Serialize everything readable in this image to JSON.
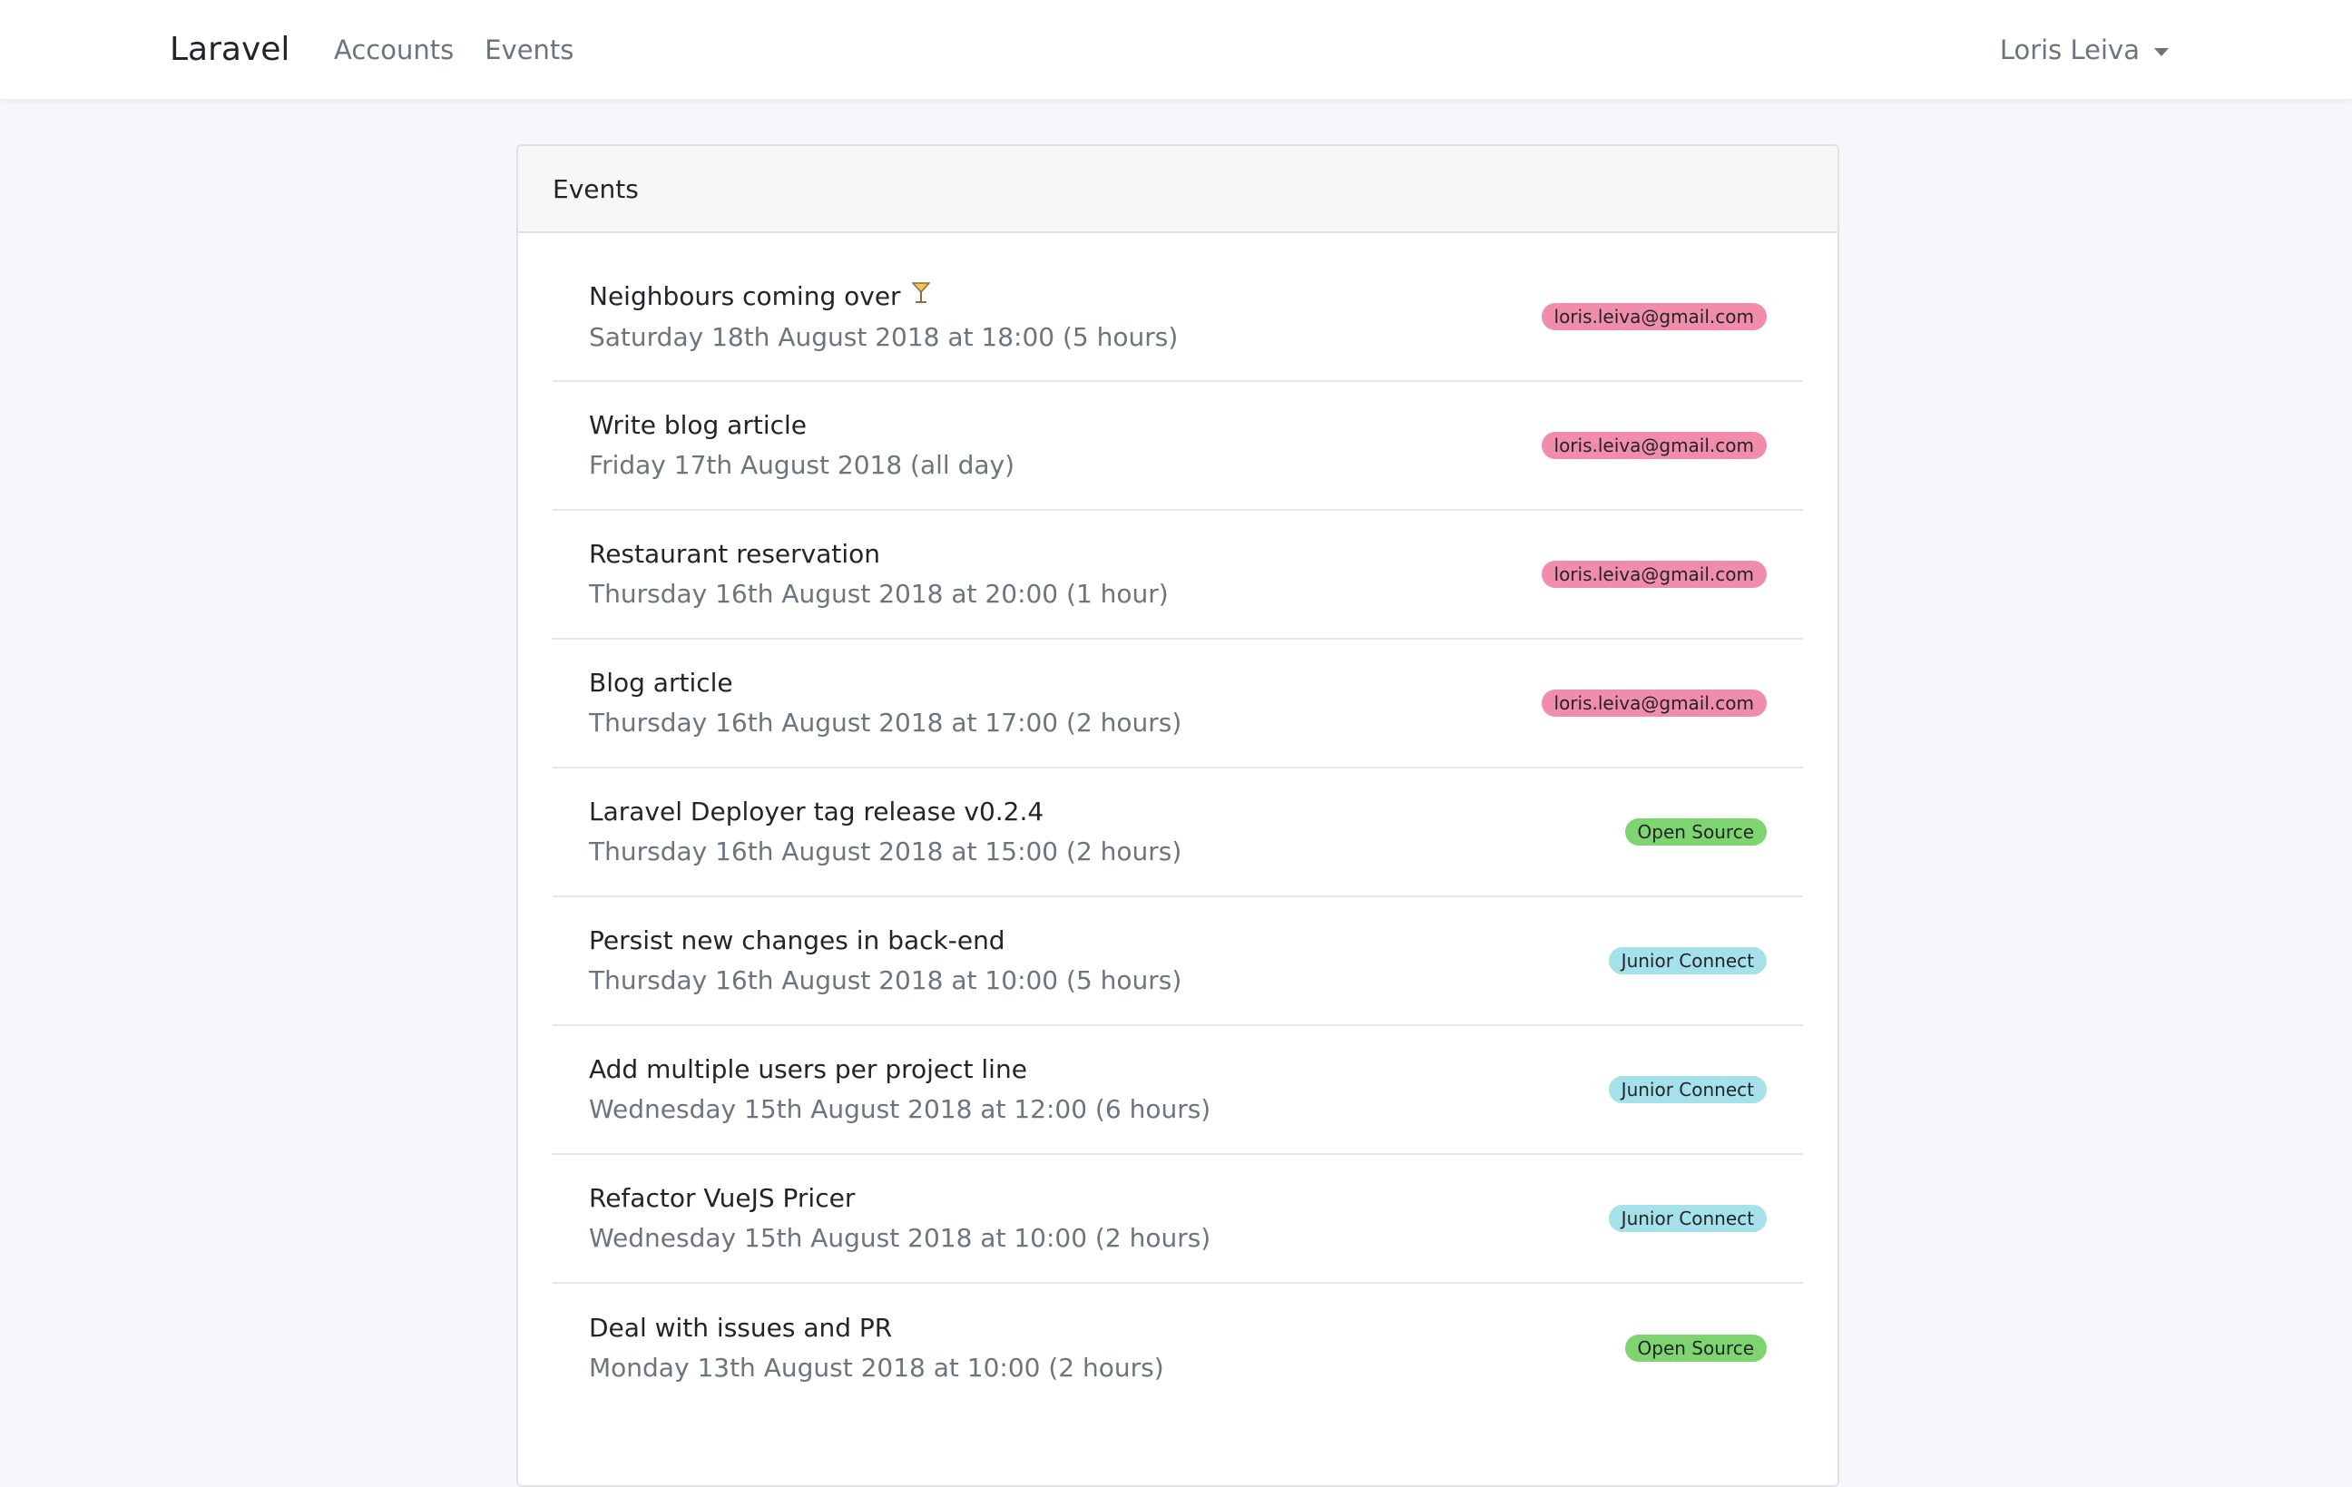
{
  "navbar": {
    "brand": "Laravel",
    "links": [
      "Accounts",
      "Events"
    ],
    "user": "Loris Leiva"
  },
  "card": {
    "header": "Events"
  },
  "colors": {
    "badge_pink": "#f28cab",
    "badge_green": "#7ed56f",
    "badge_cyan": "#a5e1ea"
  },
  "events": [
    {
      "title": "Neighbours coming over",
      "icon": "cocktail-icon",
      "date": "Saturday 18th August 2018 at 18:00 (5 hours)",
      "badge": "loris.leiva@gmail.com",
      "badge_color": "#f28cab"
    },
    {
      "title": "Write blog article",
      "date": "Friday 17th August 2018 (all day)",
      "badge": "loris.leiva@gmail.com",
      "badge_color": "#f28cab"
    },
    {
      "title": "Restaurant reservation",
      "date": "Thursday 16th August 2018 at 20:00 (1 hour)",
      "badge": "loris.leiva@gmail.com",
      "badge_color": "#f28cab"
    },
    {
      "title": "Blog article",
      "date": "Thursday 16th August 2018 at 17:00 (2 hours)",
      "badge": "loris.leiva@gmail.com",
      "badge_color": "#f28cab"
    },
    {
      "title": "Laravel Deployer tag release v0.2.4",
      "date": "Thursday 16th August 2018 at 15:00 (2 hours)",
      "badge": "Open Source",
      "badge_color": "#7ed56f"
    },
    {
      "title": "Persist new changes in back-end",
      "date": "Thursday 16th August 2018 at 10:00 (5 hours)",
      "badge": "Junior Connect",
      "badge_color": "#a5e1ea"
    },
    {
      "title": "Add multiple users per project line",
      "date": "Wednesday 15th August 2018 at 12:00 (6 hours)",
      "badge": "Junior Connect",
      "badge_color": "#a5e1ea"
    },
    {
      "title": "Refactor VueJS Pricer",
      "date": "Wednesday 15th August 2018 at 10:00 (2 hours)",
      "badge": "Junior Connect",
      "badge_color": "#a5e1ea"
    },
    {
      "title": "Deal with issues and PR",
      "date": "Monday 13th August 2018 at 10:00 (2 hours)",
      "badge": "Open Source",
      "badge_color": "#7ed56f"
    }
  ]
}
